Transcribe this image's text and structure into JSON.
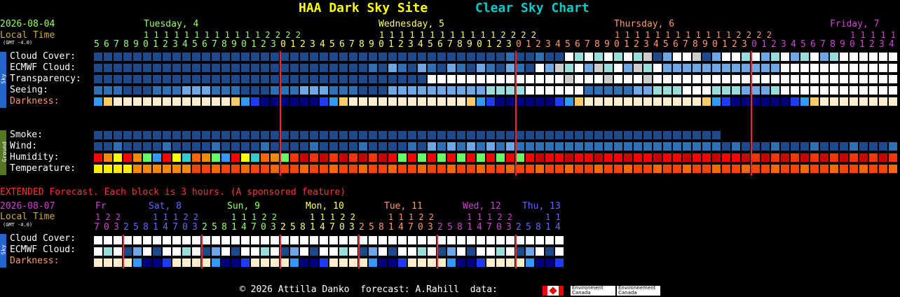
{
  "header": {
    "site": "HAA Dark Sky Site",
    "chart": "Clear Sky Chart",
    "site_color": "#ffff00",
    "chart_color": "#00cccc"
  },
  "top": {
    "date": "2026-08-04",
    "local_time": "Local Time",
    "gmt": "(GMT -4.0)",
    "days": [
      {
        "label": "Tuesday, 4",
        "color": "#99ff66"
      },
      {
        "label": "Wednesday, 5",
        "color": "#ffff66"
      },
      {
        "label": "Thursday, 6",
        "color": "#ff9966"
      },
      {
        "label": "Friday, 7",
        "color": "#cc44cc"
      }
    ],
    "tens_row": [
      "1 1 1 1 1 1 1 1 1 1 1 1 2 2 2 2",
      "1 1 1 1 1 1 1 1 1 1 1 1 2 2 2 2",
      "1 1 1 1 1 1 1 1 1 1 1 1 2 2 2 2",
      "1 1 1 1 1"
    ],
    "hours": "5678901234567890123012345678901234567890123012345678901234567890123012345678901234",
    "rows_sky": [
      "Cloud Cover:",
      "ECMWF Cloud:",
      "Transparency:",
      "Seeing:",
      "Darkness:"
    ],
    "rows_ground": [
      "Smoke:",
      "Wind:",
      "Humidity:",
      "Temperature:"
    ],
    "sky_tab": "Sky",
    "ground_tab": "Ground"
  },
  "extended": {
    "note": "EXTENDED Forecast. Each block is 3 hours. (A sponsored feature)",
    "date": "2026-08-07",
    "local_time": "Local Time",
    "gmt": "(GMT -4.0)",
    "days": [
      {
        "label": "Fr",
        "color": "#cc44cc"
      },
      {
        "label": "Sat, 8",
        "color": "#6666ff"
      },
      {
        "label": "Sun, 9",
        "color": "#99ff66"
      },
      {
        "label": "Mon, 10",
        "color": "#ffff66"
      },
      {
        "label": "Tue, 11",
        "color": "#ff9966"
      },
      {
        "label": "Wed, 12",
        "color": "#cc44cc"
      },
      {
        "label": "Thu, 13",
        "color": "#6666ff"
      }
    ],
    "tens": [
      "1 2 2",
      "1 1 1 2 2",
      "1 1 1 2 2",
      "1 1 1 2 2",
      "1 1 1 2 2",
      "1 1 1 2 2",
      "1 1"
    ],
    "hours": "703258147032581470325814703258147032581470325814",
    "rows": [
      "Cloud Cover:",
      "ECMWF Cloud:",
      "Darkness:"
    ],
    "sky_tab": "Sky"
  },
  "footer": {
    "text": "© 2026 Attilla Danko  forecast: A.Rahill  data:",
    "ec1": "Environment\nCanada",
    "ec2": "Environnement\nCanada"
  },
  "colors": {
    "darkblue": "#1e4a8c",
    "midblue": "#2f6fb5",
    "lightblue": "#6fa6e6",
    "cyan": "#99dddd",
    "white": "#ffffff",
    "grey": "#cccccc",
    "red": "#ff0000",
    "orange": "#ff6600",
    "darkorange": "#ff4400",
    "yellow": "#ffdd00"
  }
}
